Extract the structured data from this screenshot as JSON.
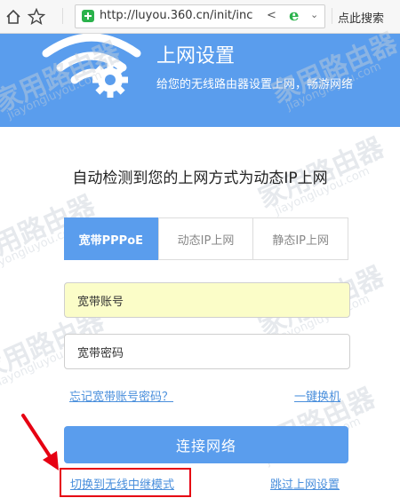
{
  "browser": {
    "url": "http://luyou.360.cn/init/inc",
    "search_hint": "点此搜索",
    "engine_glyph": "e"
  },
  "header": {
    "title": "上网设置",
    "subtitle": "给您的无线路由器设置上网，畅游网络"
  },
  "main": {
    "headline": "自动检测到您的上网方式为动态IP上网",
    "tabs": [
      {
        "label": "宽带PPPoE",
        "active": true
      },
      {
        "label": "动态IP上网",
        "active": false
      },
      {
        "label": "静态IP上网",
        "active": false
      }
    ],
    "account_placeholder": "宽带账号",
    "password_placeholder": "宽带密码",
    "forgot_link": "忘记宽带账号密码？",
    "one_key_link": "一键换机",
    "connect_button": "连接网络",
    "switch_link": "切换到无线中继模式",
    "skip_link": "跳过上网设置"
  },
  "watermarks": {
    "brand": "家用路由器",
    "domain": "jiayongluyou.com"
  },
  "colors": {
    "accent": "#5a9ded",
    "link": "#4a8fdc",
    "highlight": "#e60012",
    "account_field_bg": "#fbfdc8"
  }
}
